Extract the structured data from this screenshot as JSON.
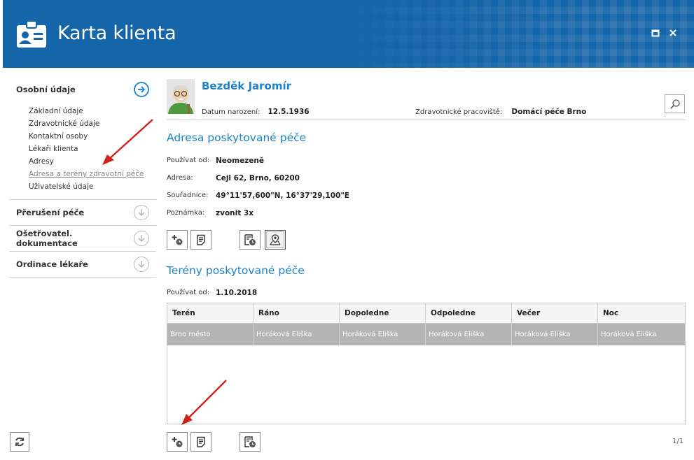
{
  "window": {
    "title": "Karta klienta",
    "maximize_icon": "maximize-icon",
    "close_icon": "close-icon"
  },
  "sidebar": {
    "sections": [
      {
        "label": "Osobní údaje",
        "expanded": true,
        "items": [
          "Základní údaje",
          "Zdravotnické údaje",
          "Kontaktní osoby",
          "Lékaři klienta",
          "Adresy",
          "Adresa a terény zdravotní péče",
          "Uživatelské údaje"
        ],
        "selected_item": "Adresa a terény zdravotní péče"
      },
      {
        "label": "Přerušení péče",
        "expanded": false
      },
      {
        "label": "Ošetřovatel. dokumentace",
        "expanded": false
      },
      {
        "label": "Ordinace lékaře",
        "expanded": false
      }
    ]
  },
  "client": {
    "name": "Bezděk Jaromír",
    "dob_label": "Datum narození:",
    "dob": "12.5.1936",
    "workplace_label": "Zdravotnické pracoviště:",
    "workplace": "Domácí péče Brno"
  },
  "address_section": {
    "title": "Adresa poskytované péče",
    "fields": [
      {
        "label": "Používat od:",
        "value": "Neomezeně"
      },
      {
        "label": "Adresa:",
        "value": "Cejl 62, Brno, 60200"
      },
      {
        "label": "Souřadnice:",
        "value": "49°11'57,600\"N, 16°37'29,100\"E"
      },
      {
        "label": "Poznámka:",
        "value": "zvonit 3x"
      }
    ]
  },
  "terrain_section": {
    "title": "Terény poskytované péče",
    "valid_from_label": "Používat od:",
    "valid_from": "1.10.2018",
    "columns": [
      "Terén",
      "Ráno",
      "Dopoledne",
      "Odpoledne",
      "Večer",
      "Noc"
    ],
    "rows": [
      [
        "Brno město",
        "Horáková Eliška",
        "Horáková Eliška",
        "Horáková Eliška",
        "Horáková Eliška",
        "Horáková Eliška"
      ]
    ],
    "pager": "1/1"
  },
  "colors": {
    "header_bg": "#1565a9",
    "accent": "#1e82c8",
    "selected_row": "#b5b5b5",
    "annotation_arrow": "#d0211c"
  }
}
